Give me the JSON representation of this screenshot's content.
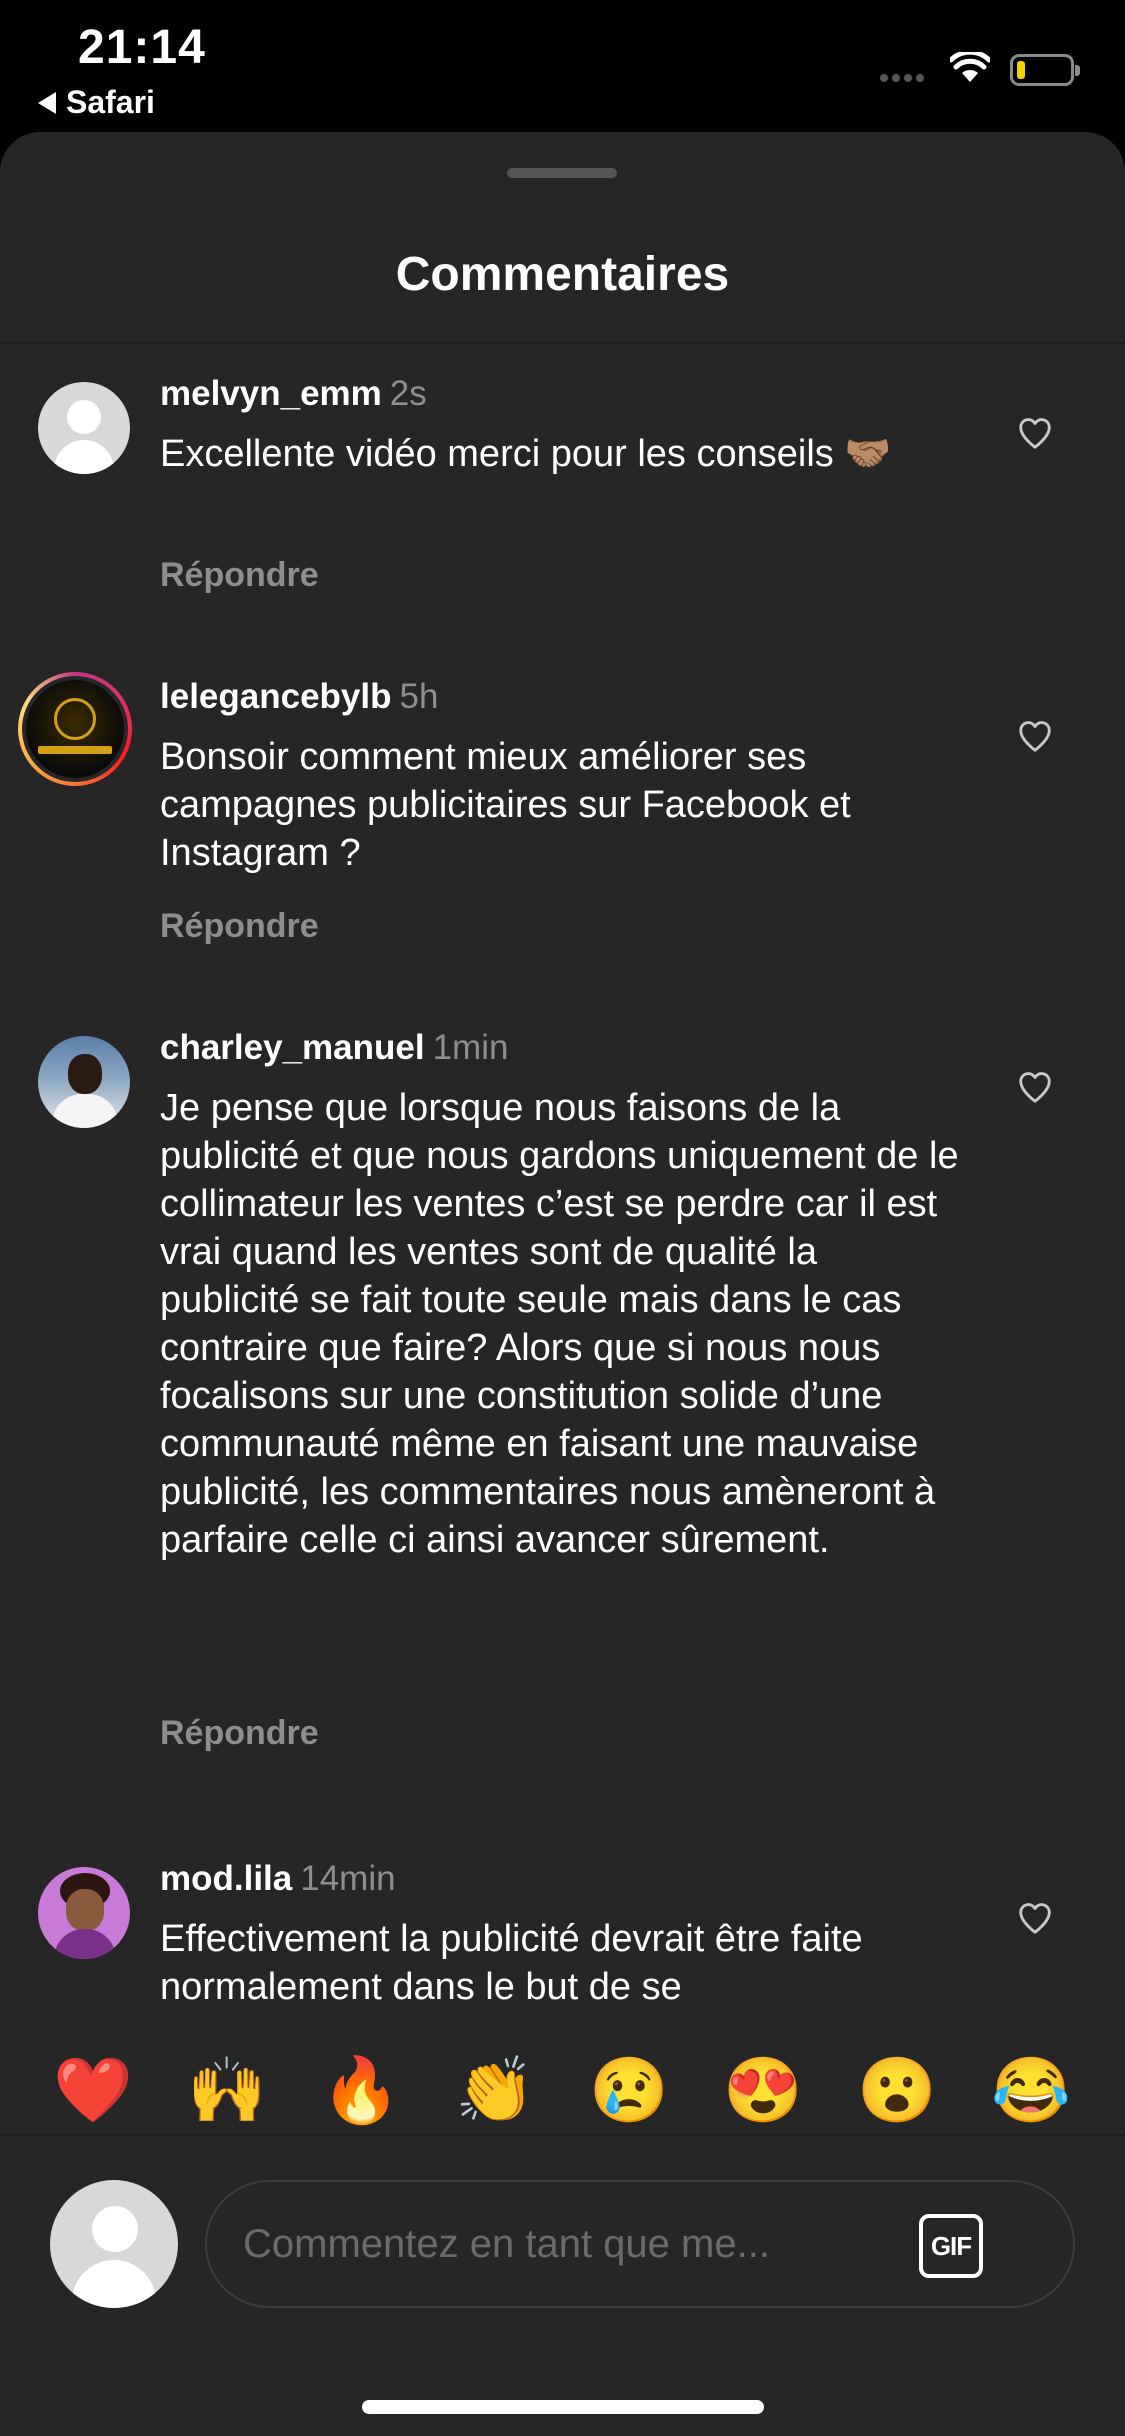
{
  "status_bar": {
    "time": "21:14",
    "back_app": "Safari"
  },
  "sheet": {
    "title": "Commentaires"
  },
  "comments": [
    {
      "user": "melvyn_emm",
      "time": "2s",
      "text": "Excellente vidéo merci pour les conseils 🤝🏽",
      "reply": "Répondre",
      "avatar": "default-avatar"
    },
    {
      "user": "lelegancebylb",
      "time": "5h",
      "text": "Bonsoir comment mieux améliorer ses campagnes publicitaires sur Facebook et Instagram ?",
      "reply": "Répondre",
      "avatar": "story-ring-logo"
    },
    {
      "user": "charley_manuel",
      "time": "1min",
      "text": "Je pense que lorsque nous faisons de la publicité et que nous gardons uniquement de le collimateur les ventes c’est se perdre car il est vrai quand les ventes sont de qualité la publicité se fait toute seule mais dans le cas contraire que faire? Alors que si nous nous focalisons sur une constitution solide d’une communauté même en faisant une mauvaise publicité, les commentaires nous amèneront à parfaire celle ci ainsi avancer sûrement.",
      "reply": "Répondre",
      "avatar": "photo"
    },
    {
      "user": "mod.lila",
      "time": "14min",
      "text": "Effectivement la publicité devrait être faite normalement dans le but de se",
      "reply": "",
      "avatar": "memoji"
    }
  ],
  "emoji_bar": [
    "❤️",
    "🙌",
    "🔥",
    "👏",
    "😢",
    "😍",
    "😮",
    "😂"
  ],
  "composer": {
    "placeholder": "Commentez en tant que me...",
    "gif_label": "GIF"
  },
  "icons": {
    "like": "heart-outline-icon",
    "gif": "gif-icon",
    "back": "back-arrow-icon",
    "wifi": "wifi-icon",
    "battery": "battery-icon"
  },
  "colors": {
    "background": "#262626",
    "secondary_text": "#8e8e8e",
    "battery": "#f5d200"
  }
}
